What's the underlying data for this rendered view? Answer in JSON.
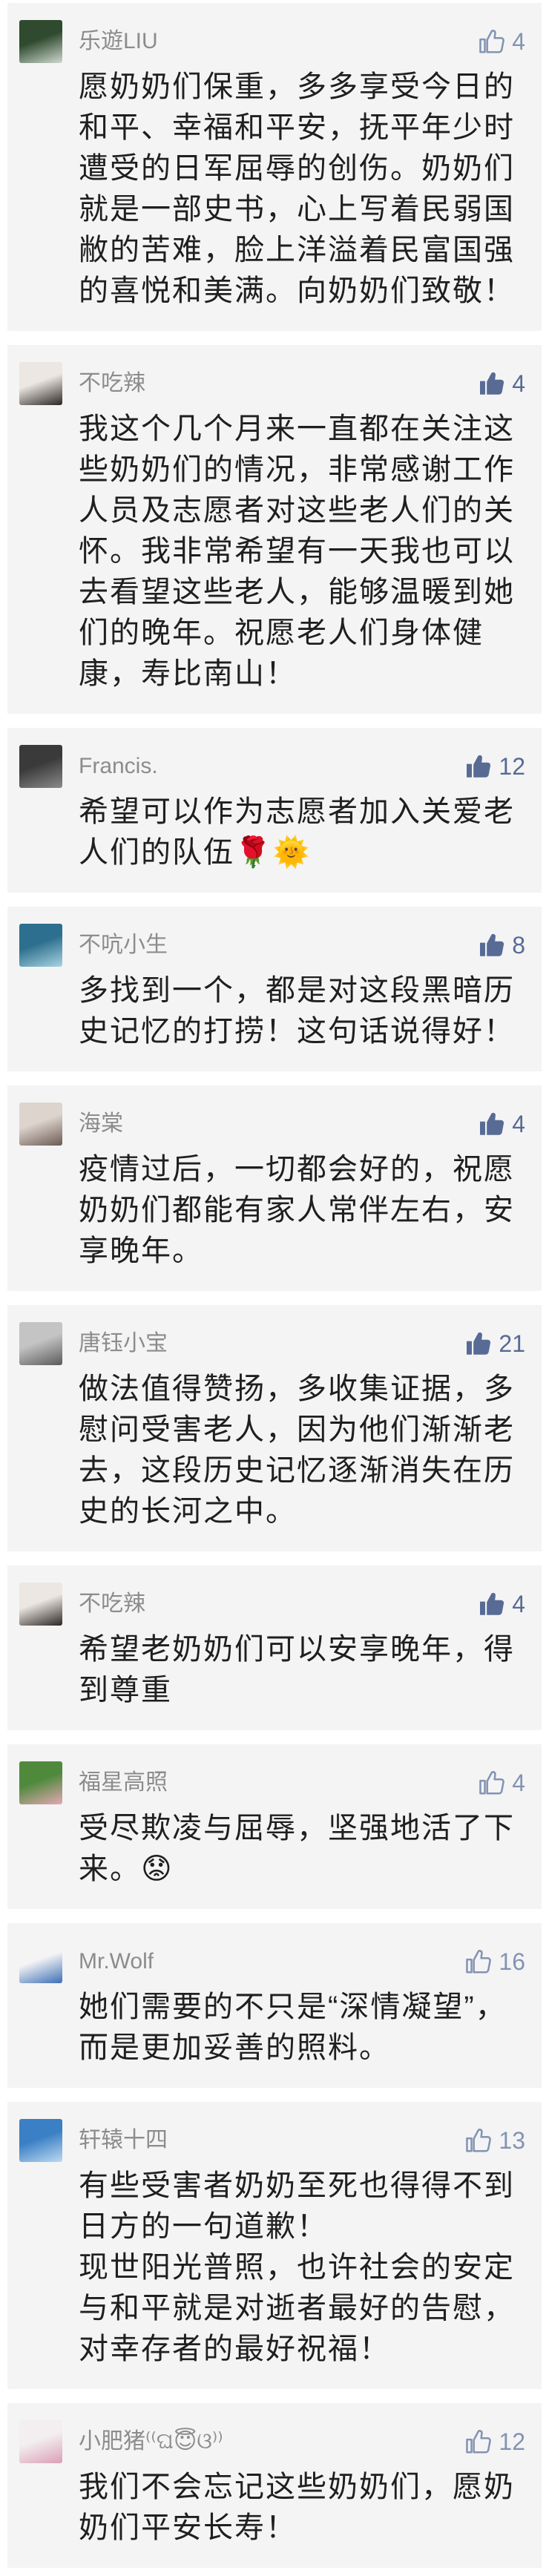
{
  "colors": {
    "page_bg": "#ffffff",
    "card_bg": "#f4f4f4",
    "text": "#1f1f1f",
    "user": "#8c8c8c",
    "liked": "#576b95",
    "unliked": "#8394b3"
  },
  "icons": {
    "like": "thumbs-up-icon"
  },
  "comments": [
    {
      "user": "乐遊LIU",
      "likes": 4,
      "liked": false,
      "avatar_colors": [
        "#2f4a2e",
        "#cfd8cf"
      ],
      "text": "愿奶奶们保重，多多享受今日的和平、幸福和平安，抚平年少时遭受的日军屈辱的创伤。奶奶们就是一部史书，心上写着民弱国敝的苦难，脸上洋溢着民富国强的喜悦和美满。向奶奶们致敬！"
    },
    {
      "user": "不吃辣",
      "likes": 4,
      "liked": true,
      "avatar_colors": [
        "#ece7e2",
        "#2b2622"
      ],
      "text": "我这个几个月来一直都在关注这些奶奶们的情况，非常感谢工作人员及志愿者对这些老人们的关怀。我非常希望有一天我也可以去看望这些老人，能够温暖到她们的晚年。祝愿老人们身体健康，寿比南山！"
    },
    {
      "user": "Francis.",
      "likes": 12,
      "liked": true,
      "avatar_colors": [
        "#3a3a3a",
        "#8a8a8a"
      ],
      "text": "希望可以作为志愿者加入关爱老人们的队伍🌹🌞"
    },
    {
      "user": "不吭小生",
      "likes": 8,
      "liked": true,
      "avatar_colors": [
        "#2d6f8e",
        "#a9d3e0"
      ],
      "text": "多找到一个，都是对这段黑暗历史记忆的打捞！这句话说得好！"
    },
    {
      "user": "海棠",
      "likes": 4,
      "liked": true,
      "avatar_colors": [
        "#ddd4cd",
        "#6b5a52"
      ],
      "text": "疫情过后，一切都会好的，祝愿奶奶们都能有家人常伴左右，安享晚年。"
    },
    {
      "user": "唐钰小宝",
      "likes": 21,
      "liked": true,
      "avatar_colors": [
        "#c4c4c4",
        "#5a5a5a"
      ],
      "text": "做法值得赞扬，多收集证据，多慰问受害老人，因为他们渐渐老去，这段历史记忆逐渐消失在历史的长河之中。"
    },
    {
      "user": "不吃辣",
      "likes": 4,
      "liked": true,
      "avatar_colors": [
        "#ece7e2",
        "#2b2622"
      ],
      "text": "希望老奶奶们可以安享晚年，得到尊重"
    },
    {
      "user": "福星高照",
      "likes": 4,
      "liked": false,
      "avatar_colors": [
        "#4f8a3c",
        "#e6a7b4"
      ],
      "text": "受尽欺凌与屈辱，坚强地活了下来。😟"
    },
    {
      "user": "Mr.Wolf",
      "likes": 16,
      "liked": false,
      "avatar_colors": [
        "#f4f4f4",
        "#3b6fb6"
      ],
      "text": "她们需要的不只是“深情凝望”，而是更加妥善的照料。"
    },
    {
      "user": "轩辕十四",
      "likes": 13,
      "liked": false,
      "avatar_colors": [
        "#3b7fc4",
        "#bcdaf2"
      ],
      "text": "有些受害者奶奶至死也得得不到日方的一句道歉！\n现世阳光普照，也许社会的安定与和平就是对逝者最好的告慰，对幸存者的最好祝福！"
    },
    {
      "user": "小肥猪⁽⁽ଘ😇ଓ⁾⁾",
      "likes": 12,
      "liked": false,
      "avatar_colors": [
        "#f3eef0",
        "#d9a0b5"
      ],
      "text": "我们不会忘记这些奶奶们，愿奶奶们平安长寿！"
    }
  ]
}
